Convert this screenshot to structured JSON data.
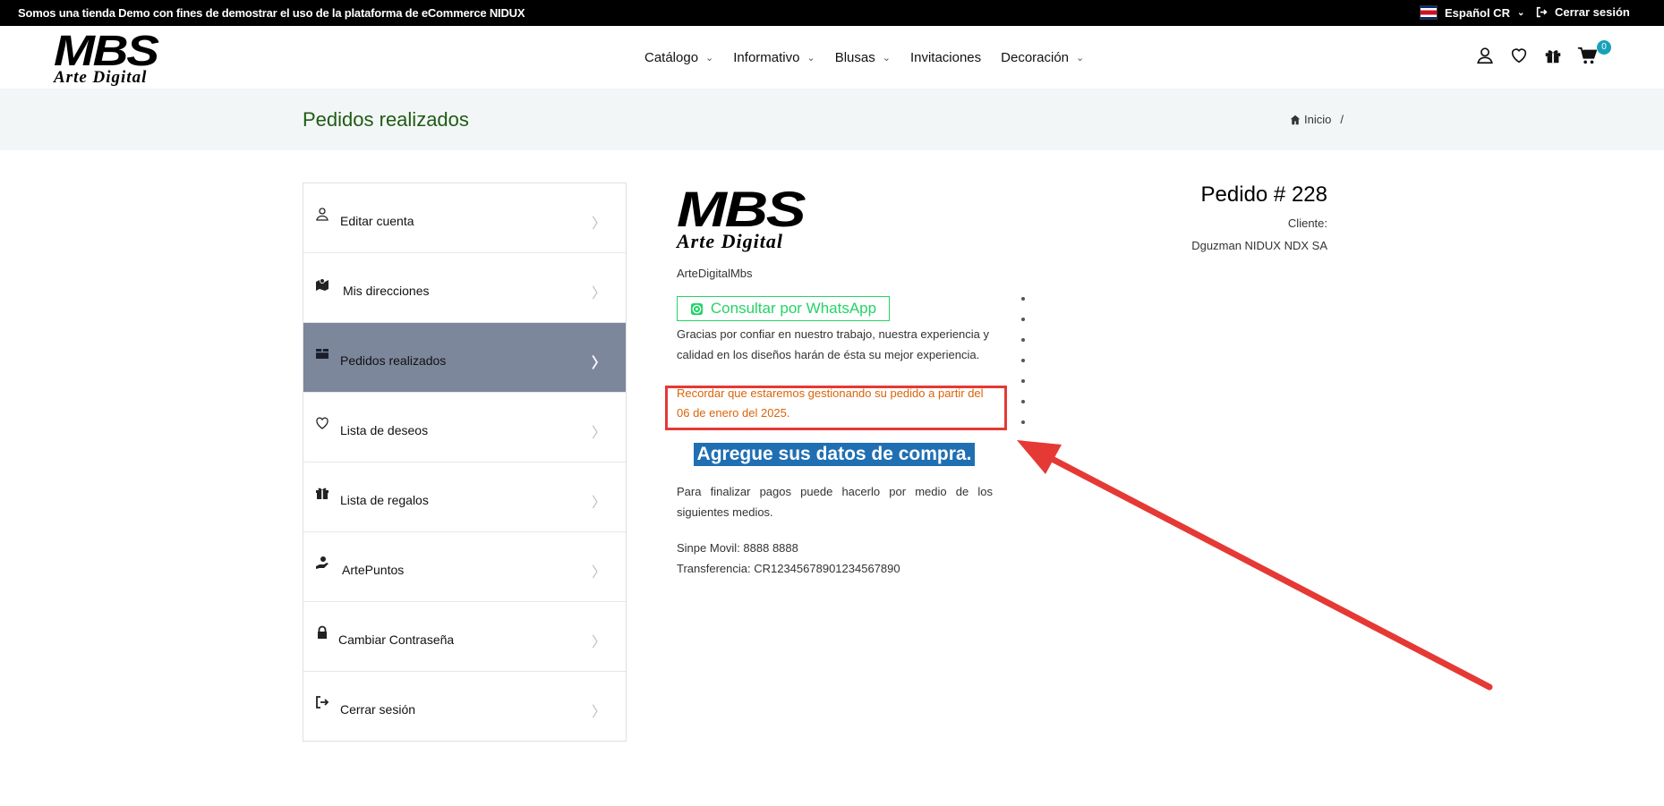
{
  "topbar": {
    "message": "Somos una tienda Demo con fines de demostrar el uso de la plataforma de eCommerce NIDUX",
    "language": "Español CR",
    "logout": "Cerrar sesión"
  },
  "brand": {
    "logo_big": "MBS",
    "logo_small": "Arte Digital"
  },
  "nav": {
    "items": [
      {
        "label": "Catálogo",
        "has_dropdown": true
      },
      {
        "label": "Informativo",
        "has_dropdown": true
      },
      {
        "label": "Blusas",
        "has_dropdown": true
      },
      {
        "label": "Invitaciones",
        "has_dropdown": false
      },
      {
        "label": "Decoración",
        "has_dropdown": true
      }
    ]
  },
  "header_icons": {
    "cart_count": "0"
  },
  "page": {
    "title": "Pedidos realizados",
    "breadcrumb_home": "Inicio",
    "breadcrumb_sep": "/"
  },
  "sidebar": {
    "items": [
      {
        "label": "Editar cuenta",
        "icon": "user-icon",
        "active": false
      },
      {
        "label": "Mis direcciones",
        "icon": "map-icon",
        "active": false
      },
      {
        "label": "Pedidos realizados",
        "icon": "box-icon",
        "active": true
      },
      {
        "label": "Lista de deseos",
        "icon": "heart-icon",
        "active": false
      },
      {
        "label": "Lista de regalos",
        "icon": "gift-icon",
        "active": false
      },
      {
        "label": "ArtePuntos",
        "icon": "hand-coin-icon",
        "active": false
      },
      {
        "label": "Cambiar Contraseña",
        "icon": "lock-icon",
        "active": false
      },
      {
        "label": "Cerrar sesión",
        "icon": "logout-icon",
        "active": false
      }
    ],
    "arrow": "〉"
  },
  "order": {
    "store_name": "ArteDigitalMbs",
    "whatsapp_label": "Consultar por WhatsApp",
    "thanks": "Gracias por confiar en nuestro trabajo, nuestra experiencia y calidad en los diseños harán de ésta su mejor experiencia.",
    "reminder": "Recordar que estaremos gestionando su pedido a partir del 06 de enero del 2025.",
    "cta": "Agregue sus datos de compra.",
    "payment_intro": "Para finalizar pagos puede hacerlo por medio de los siguientes medios.",
    "sinpe": "Sinpe Movil: 8888 8888",
    "transfer": "Transferencia: CR12345678901234567890",
    "number": "Pedido # 228",
    "client_label": "Cliente:",
    "client_name": "Dguzman NIDUX NDX SA"
  },
  "colors": {
    "title_green": "#1e5c14",
    "reminder_orange": "#d9640a",
    "cta_blue": "#1f6fb2",
    "whatsapp_green": "#25d366",
    "active_sidebar": "#7c879c",
    "annotation_red": "#e53935"
  }
}
